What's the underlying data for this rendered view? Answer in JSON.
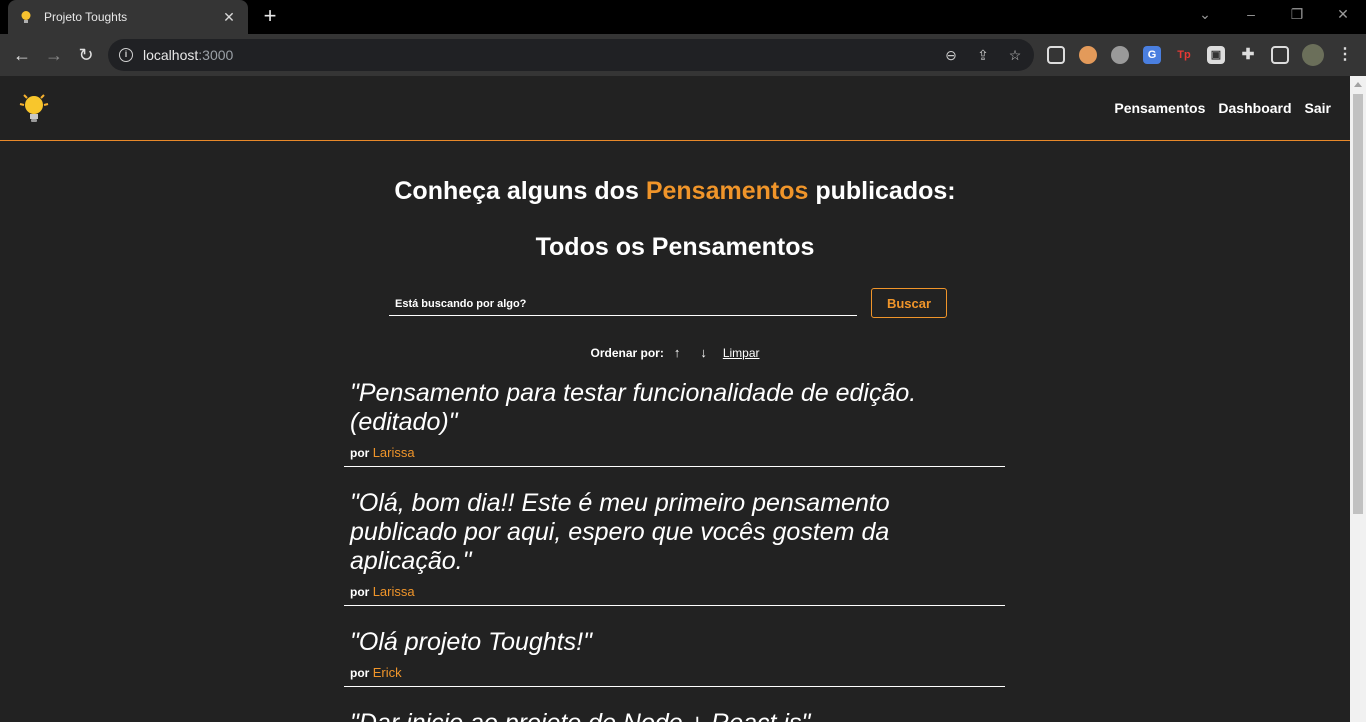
{
  "browser": {
    "tab_title": "Projeto Toughts",
    "url_host": "localhost",
    "url_port": ":3000"
  },
  "nav": {
    "links": [
      "Pensamentos",
      "Dashboard",
      "Sair"
    ]
  },
  "heading": {
    "prefix": "Conheça alguns dos ",
    "accent": "Pensamentos",
    "suffix": " publicados:"
  },
  "subheading": "Todos os Pensamentos",
  "search": {
    "placeholder": "Está buscando por algo?",
    "button_label": "Buscar"
  },
  "order": {
    "label": "Ordenar por:",
    "asc": "↑",
    "desc": "↓",
    "clear": "Limpar"
  },
  "thoughts": [
    {
      "text": "\"Pensamento para testar funcionalidade de edição. (editado)\"",
      "by": "por",
      "author": "Larissa"
    },
    {
      "text": "\"Olá, bom dia!! Este é meu primeiro pensamento publicado por aqui, espero que vocês gostem da aplicação.\"",
      "by": "por",
      "author": "Larissa"
    },
    {
      "text": "\"Olá projeto Toughts!\"",
      "by": "por",
      "author": "Erick"
    },
    {
      "text": "\"Dar inicio ao projeto de Node + React.js\"",
      "by": "por",
      "author": ""
    }
  ],
  "colors": {
    "accent": "#f0952a",
    "background": "#222222"
  }
}
